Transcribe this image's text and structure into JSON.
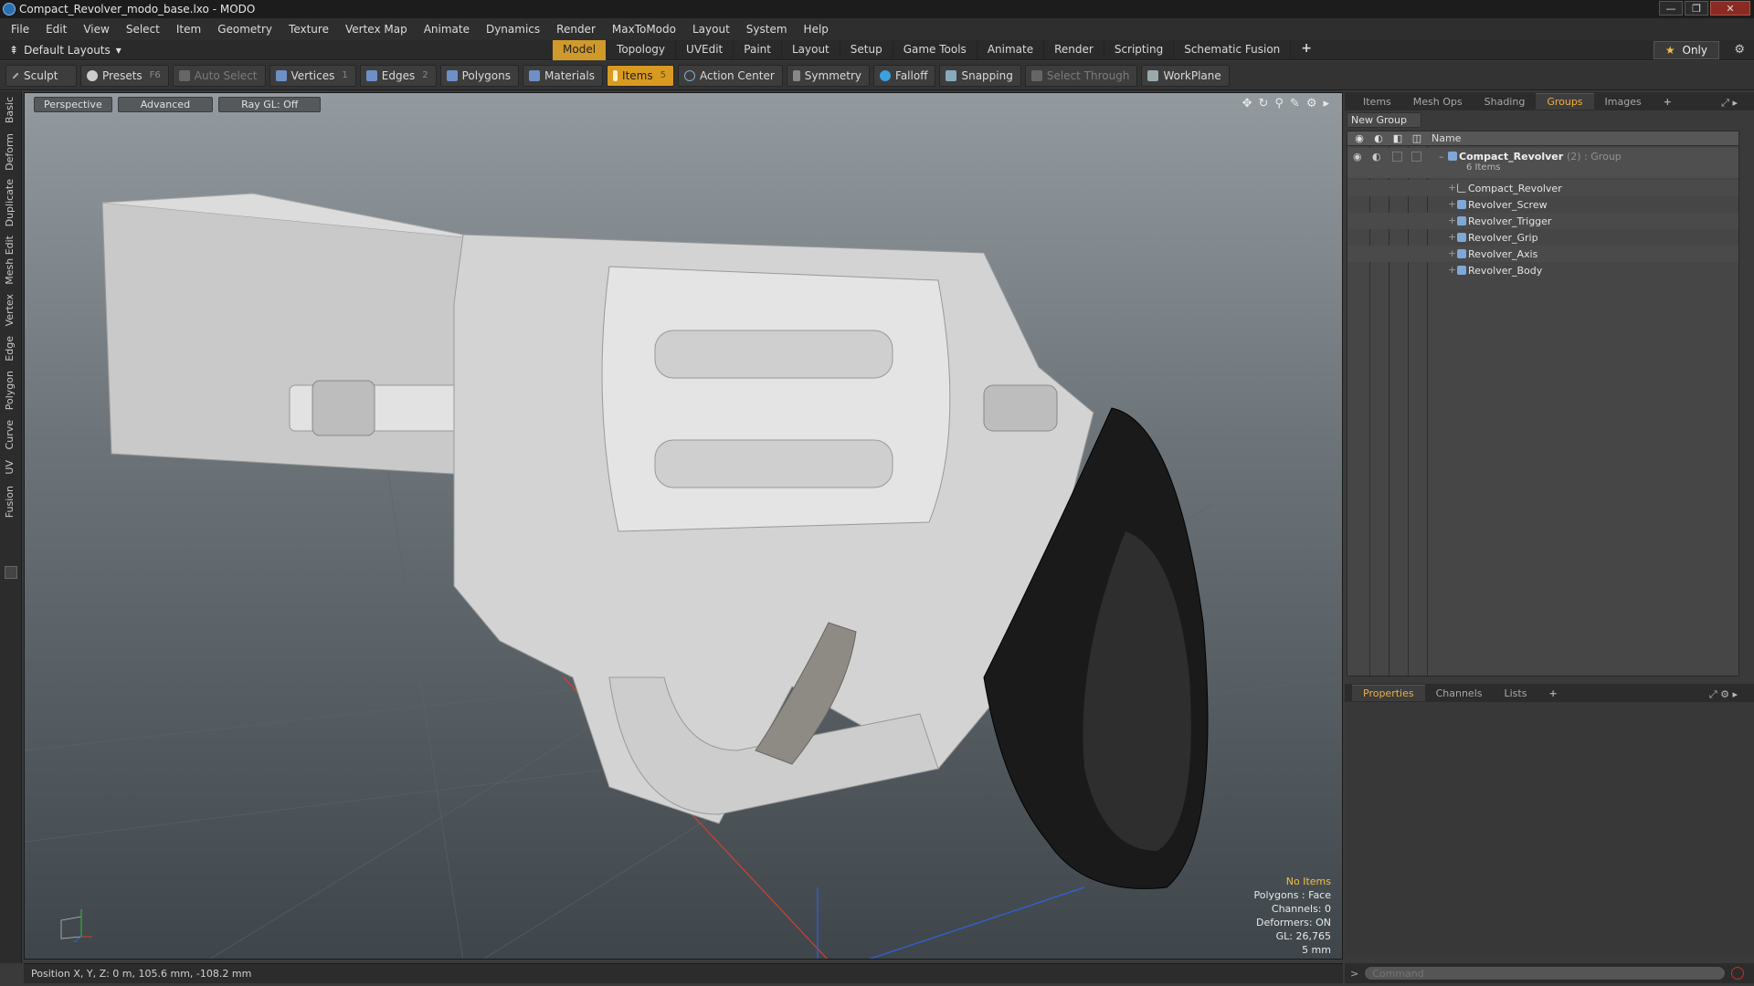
{
  "window": {
    "title": "Compact_Revolver_modo_base.lxo - MODO",
    "controls": [
      "—",
      "❐",
      "✕"
    ]
  },
  "menu": [
    "File",
    "Edit",
    "View",
    "Select",
    "Item",
    "Geometry",
    "Texture",
    "Vertex Map",
    "Animate",
    "Dynamics",
    "Render",
    "MaxToModo",
    "Layout",
    "System",
    "Help"
  ],
  "layoutbar": {
    "layouts_label": "Default Layouts",
    "tabs": [
      "Model",
      "Topology",
      "UVEdit",
      "Paint",
      "Layout",
      "Setup",
      "Game Tools",
      "Animate",
      "Render",
      "Scripting",
      "Schematic Fusion"
    ],
    "active_tab": "Model",
    "plus": "+",
    "only_label": "Only"
  },
  "toolbar": {
    "sculpt": "Sculpt",
    "presets": "Presets",
    "presets_key": "F6",
    "auto_select": "Auto Select",
    "vertices": "Vertices",
    "vertices_key": "1",
    "edges": "Edges",
    "edges_key": "2",
    "polygons": "Polygons",
    "materials": "Materials",
    "items": "Items",
    "items_key": "5",
    "action_center": "Action Center",
    "symmetry": "Symmetry",
    "falloff": "Falloff",
    "snapping": "Snapping",
    "select_through": "Select Through",
    "workplane": "WorkPlane"
  },
  "lefttabs": [
    "Basic",
    "Deform",
    "Duplicate",
    "Mesh Edit",
    "Vertex",
    "Edge",
    "Polygon",
    "Curve",
    "UV",
    "Fusion"
  ],
  "viewport": {
    "view": "Perspective",
    "mode": "Advanced",
    "raygl": "Ray GL: Off",
    "info": {
      "selection": "No Items",
      "polygons": "Polygons : Face",
      "channels": "Channels: 0",
      "deformers": "Deformers: ON",
      "gl": "GL: 26,765",
      "scale": "5 mm"
    },
    "colors": {
      "accent": "#f0c040",
      "x_axis": "#d04030",
      "y_axis": "#30c030",
      "z_axis": "#3060e0"
    }
  },
  "status": {
    "position": "Position X, Y, Z:  0 m, 105.6 mm, -108.2 mm"
  },
  "rightpanel": {
    "tabs": [
      "Items",
      "Mesh Ops",
      "Shading",
      "Groups",
      "Images"
    ],
    "active_tab": "Groups",
    "plus": "+",
    "new_group": "New Group",
    "column_name": "Name",
    "group": {
      "name": "Compact_Revolver",
      "count": "(2) : Group",
      "sub": "6 Items"
    },
    "items": [
      "Compact_Revolver",
      "Revolver_Screw",
      "Revolver_Trigger",
      "Revolver_Grip",
      "Revolver_Axis",
      "Revolver_Body"
    ],
    "props_tabs": [
      "Properties",
      "Channels",
      "Lists"
    ],
    "props_active": "Properties"
  },
  "command": {
    "placeholder": "Command",
    "prompt": ">"
  }
}
